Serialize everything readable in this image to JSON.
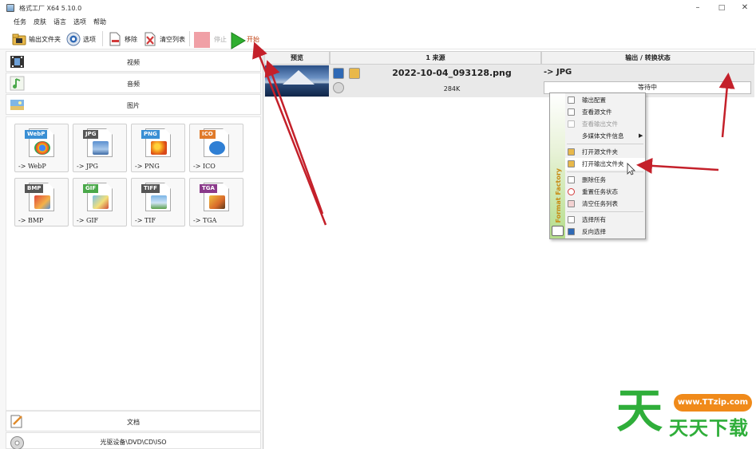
{
  "window": {
    "title": "格式工厂 X64 5.10.0",
    "minimize": "–",
    "maximize": "□",
    "close": "✕"
  },
  "menu": [
    "任务",
    "皮肤",
    "语言",
    "选项",
    "帮助"
  ],
  "toolbar": {
    "output_folder": "输出文件夹",
    "options": "选项",
    "remove": "移除",
    "clear_list": "清空列表",
    "stop": "停止",
    "start": "开始"
  },
  "categories": {
    "video": "视频",
    "audio": "音频",
    "image": "图片",
    "document": "文档",
    "disc": "光驱设备\\DVD\\CD\\ISO"
  },
  "formats": [
    {
      "tag": "WebP",
      "label": "-> WebP",
      "color": "#3a8fd4"
    },
    {
      "tag": "JPG",
      "label": "-> JPG",
      "color": "#555555"
    },
    {
      "tag": "PNG",
      "label": "-> PNG",
      "color": "#3a8fd4"
    },
    {
      "tag": "ICO",
      "label": "-> ICO",
      "color": "#e07a2a"
    },
    {
      "tag": "BMP",
      "label": "-> BMP",
      "color": "#555555"
    },
    {
      "tag": "GIF",
      "label": "-> GIF",
      "color": "#4aa84a"
    },
    {
      "tag": "TIFF",
      "label": "-> TIF",
      "color": "#555555"
    },
    {
      "tag": "TGA",
      "label": "-> TGA",
      "color": "#8a3a8a"
    }
  ],
  "table": {
    "headers": {
      "preview": "预览",
      "source": "1 来源",
      "output": "输出 / 转换状态"
    },
    "rows": [
      {
        "filename": "2022-10-04_093128.png",
        "size": "284K",
        "output_format": "-> JPG",
        "status": "等待中"
      }
    ]
  },
  "context_menu": {
    "side_text": "Format Factory",
    "items": [
      {
        "label": "输出配置",
        "disabled": false
      },
      {
        "label": "查看源文件",
        "disabled": false
      },
      {
        "label": "查看输出文件",
        "disabled": true
      },
      {
        "label": "多媒体文件信息",
        "disabled": false,
        "submenu": true
      },
      {
        "label": "打开源文件夹",
        "disabled": false
      },
      {
        "label": "打开输出文件夹",
        "disabled": false,
        "hover": true
      },
      {
        "label": "删除任务",
        "disabled": false
      },
      {
        "label": "重置任务状态",
        "disabled": false
      },
      {
        "label": "清空任务列表",
        "disabled": false
      },
      {
        "label": "选择所有",
        "disabled": false
      },
      {
        "label": "反向选择",
        "disabled": false
      }
    ]
  },
  "watermark": {
    "char": "天",
    "url": "www.TTzip.com",
    "text": "天天下载"
  },
  "colors": {
    "annotation_arrow": "#c4202a",
    "start_green": "#2fae2f",
    "watermark_green": "#2fae3a"
  }
}
